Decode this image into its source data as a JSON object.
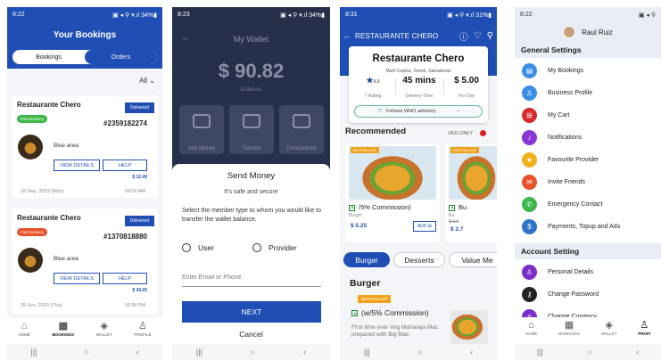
{
  "phone1": {
    "status": {
      "time": "8:22",
      "icons": "▣ ◂ ⚲ ▾.ıl 34%▮"
    },
    "title": "Your Bookings",
    "tabs": [
      "Bookings",
      "Orders"
    ],
    "filter": "All",
    "orders": [
      {
        "restaurant": "Restaurante Chero",
        "status": "Delivered",
        "type": "Fast Delivery",
        "type_color": "#3cb84a",
        "order_no": "#2359182274",
        "area": "Blue area",
        "view": "VIEW DETAILS",
        "help": "HELP",
        "price": "$ 12.49",
        "date": "18 Sep, 2023 (Mon)",
        "time": "09:06 AM"
      },
      {
        "restaurant": "Restaurante Chero",
        "status": "Delivered",
        "type": "Fast Delivery",
        "type_color": "#e8512a",
        "order_no": "#1370818880",
        "area": "Blue area",
        "view": "VIEW DETAILS",
        "help": "HELP",
        "price": "$ 34.25",
        "date": "29 Jun, 2023 (Thu)",
        "time": "10:38 PM"
      }
    ],
    "nav": [
      {
        "icon": "home-icon",
        "label": "HOME"
      },
      {
        "icon": "bookings-icon",
        "label": "BOOKINGS"
      },
      {
        "icon": "wallet-icon",
        "label": "WALLET"
      },
      {
        "icon": "profile-icon",
        "label": "PROFILE"
      }
    ]
  },
  "phone2": {
    "status": {
      "time": "8:23",
      "icons": "▣ ◂ ⚲ ▾.ıl 34%▮"
    },
    "title": "My Wallet",
    "balance": "$ 90.82",
    "balance_label": "Balance",
    "tiles": [
      "Add Money",
      "Transfer",
      "Transactions"
    ],
    "sheet": {
      "title": "Send Money",
      "subtitle": "It's safe and secure",
      "description": "Select the member type to whom you would like to transfer the wallet balance.",
      "options": [
        "User",
        "Provider"
      ],
      "input_placeholder": "Enter Email or Phone",
      "next": "NEXT",
      "cancel": "Cancel"
    }
  },
  "phone3": {
    "status": {
      "time": "8:31",
      "icons": "▣ ◂ ⚲ ▾.ıl 31%▮"
    },
    "header_title": "RESTAURANTE CHERO",
    "restaurant": {
      "name": "Restaurante Chero",
      "cuisine": "Multi Cuisine, Greek, Salvadoran",
      "rating": "4.9",
      "rating_label": "7 Rating",
      "time": "45 mins",
      "time_label": "Delivery Time",
      "price": "$ 5.00",
      "price_label": "For One",
      "advisory": "Follows WHO advisory"
    },
    "recommended": "Recommended",
    "veg_only": "VEG ONLY",
    "items": [
      {
        "badge": "BESTSELLER",
        "name": "/5% Commission)",
        "category": "Burger",
        "price": "$ 5.25",
        "add": "ADD"
      },
      {
        "badge": "BESTSELLER",
        "name": "Bu",
        "category": "Bu",
        "price": "$ 2.7",
        "old_price": "$ 3.0"
      }
    ],
    "categories": [
      "Burger",
      "Desserts",
      "Value Me"
    ],
    "section": "Burger",
    "section_badge": "BESTSELLER",
    "item_name": "(w/5% Commission)",
    "item_desc": "First time ever Veg Maharaja Mac prepared with Big Mac"
  },
  "phone4": {
    "status": {
      "time": "8:22",
      "icons": "▣ ◂ ⚲"
    },
    "user": "Raul Ruiz",
    "general_settings": "General Settings",
    "items": [
      {
        "icon": "bookings-icon",
        "label": "My Bookings",
        "color": "#3a8ee6"
      },
      {
        "icon": "business-icon",
        "label": "Business Profile",
        "color": "#3a8ee6"
      },
      {
        "icon": "cart-icon",
        "label": "My Cart",
        "color": "#d92b2b"
      },
      {
        "icon": "bell-icon",
        "label": "Notifications",
        "color": "#8a35d6"
      },
      {
        "icon": "star-icon",
        "label": "Favourite Provider",
        "color": "#f0b21a"
      },
      {
        "icon": "invite-icon",
        "label": "Invite Friends",
        "color": "#e8512a"
      },
      {
        "icon": "phone-icon",
        "label": "Emergency Contact",
        "color": "#3cb84a"
      },
      {
        "icon": "payment-icon",
        "label": "Payments, Topup and Ads",
        "color": "#2f73c8"
      }
    ],
    "account_setting": "Account Setting",
    "account_items": [
      {
        "icon": "person-icon",
        "label": "Personal Details",
        "color": "#7b2fc9"
      },
      {
        "icon": "key-icon",
        "label": "Change Password",
        "color": "#222222"
      },
      {
        "icon": "currency-icon",
        "label": "Change Currency",
        "color": "#7b2fc9"
      }
    ],
    "nav": [
      "HOME",
      "BOOKINGS",
      "WALLET",
      "PROFI"
    ]
  },
  "android_nav": [
    "|||",
    "○",
    "‹"
  ]
}
